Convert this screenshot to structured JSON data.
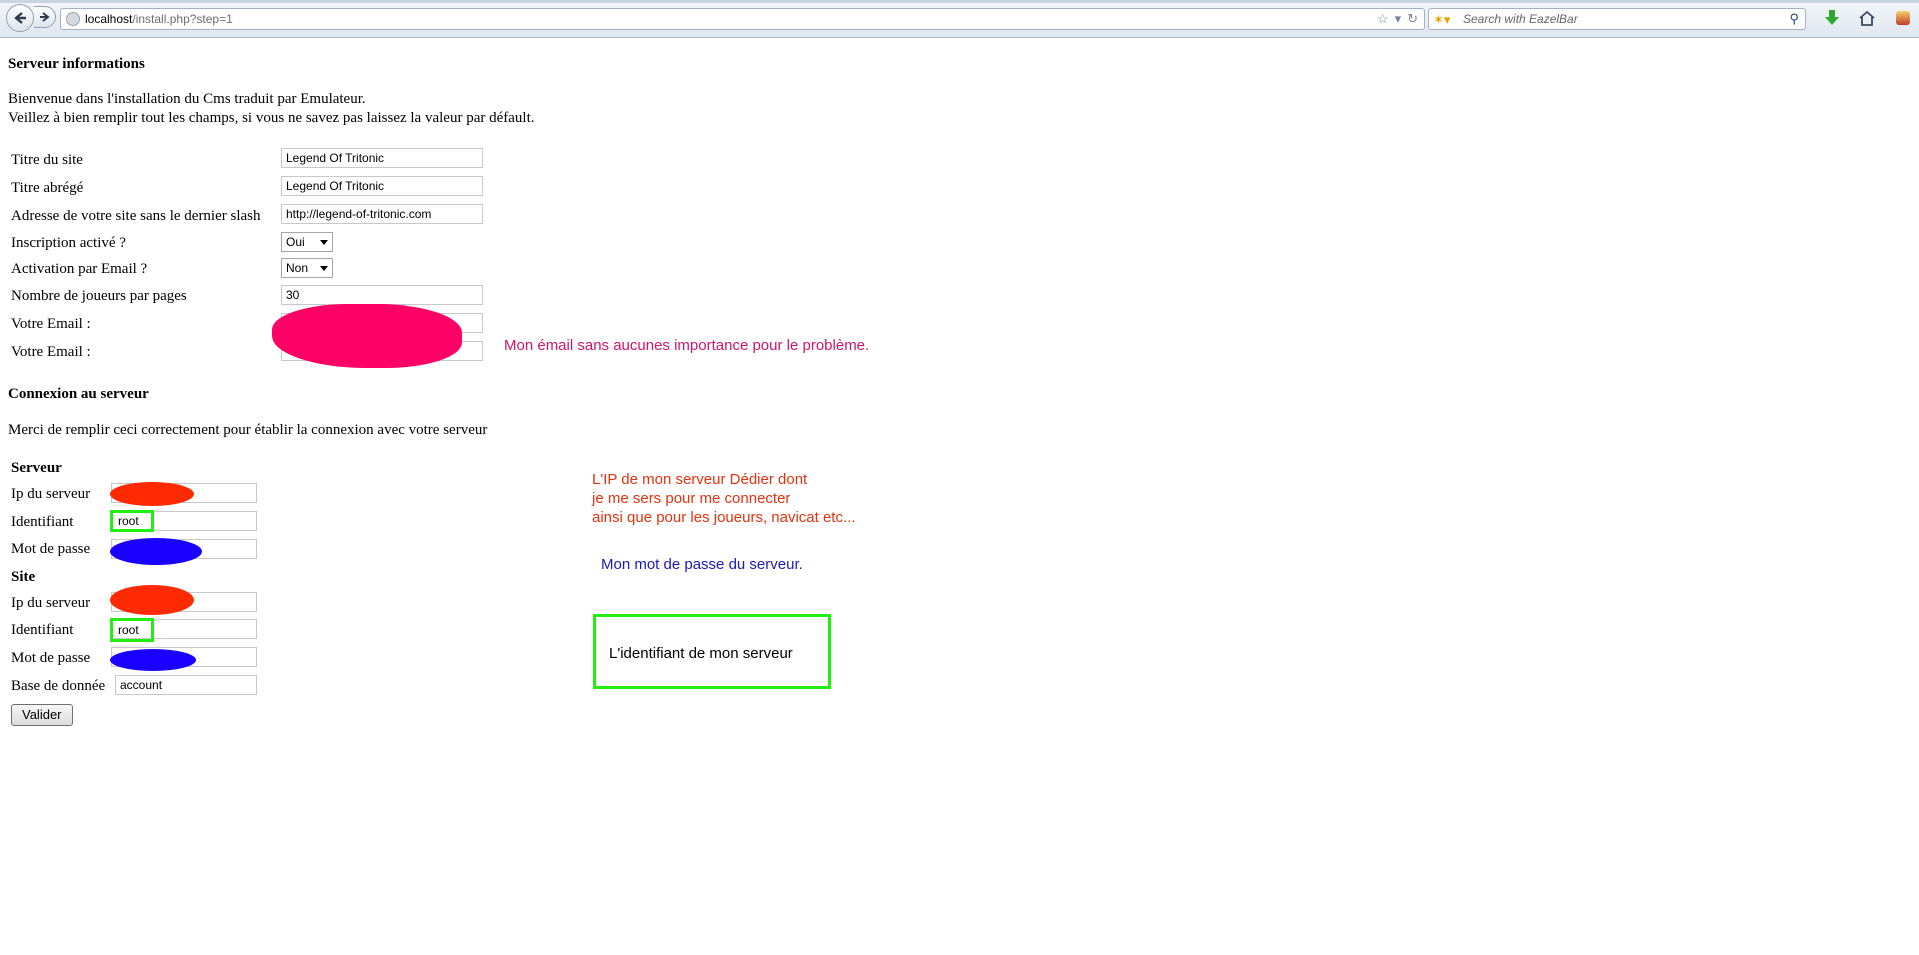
{
  "browser": {
    "url_host": "localhost",
    "url_path": "/install.php?step=1",
    "search_placeholder": "Search with EazelBar"
  },
  "serveur_info": {
    "heading": "Serveur informations",
    "intro_line1": "Bienvenue dans l'installation du Cms traduit par Emulateur.",
    "intro_line2": "Veillez à bien remplir tout les champs, si vous ne savez pas laissez la valeur par défault.",
    "fields": {
      "titre_label": "Titre du site",
      "titre_value": "Legend Of Tritonic",
      "titre_abrege_label": "Titre abrégé",
      "titre_abrege_value": "Legend Of Tritonic",
      "adresse_label": "Adresse de votre site sans le dernier slash",
      "adresse_value": "http://legend-of-tritonic.com",
      "inscription_label": "Inscription activé ?",
      "inscription_value": "Oui",
      "activation_label": "Activation par Email ?",
      "activation_value": "Non",
      "nombre_label": "Nombre de joueurs par pages",
      "nombre_value": "30",
      "email1_label": "Votre Email :",
      "email2_label": "Votre Email :"
    }
  },
  "connexion": {
    "heading": "Connexion au serveur",
    "intro": "Merci de remplir ceci correctement pour établir la connexion avec votre serveur",
    "serveur": {
      "title": "Serveur",
      "ip_label": "Ip du serveur",
      "identifiant_label": "Identifiant",
      "identifiant_value": "root",
      "password_label": "Mot de passe"
    },
    "site": {
      "title": "Site",
      "ip_label": "Ip du serveur",
      "identifiant_label": "Identifiant",
      "identifiant_value": "root",
      "password_label": "Mot de passe",
      "db_label": "Base de donnée",
      "db_value": "account"
    },
    "submit_label": "Valider"
  },
  "annotations": {
    "email_note": "Mon émail sans aucunes importance pour le problème.",
    "ip_note_line1": "L'IP de mon serveur Dédier dont",
    "ip_note_line2": "je me sers pour me connecter",
    "ip_note_line3": "ainsi que pour les joueurs, navicat etc...",
    "password_note": "Mon mot de passe du serveur.",
    "identifiant_note": "L'identifiant de mon serveur"
  },
  "colors": {
    "email_redaction": "#ff0066",
    "ip_redaction": "#ff2a00",
    "password_redaction": "#1a00ff",
    "identifiant_highlight": "#22ee11",
    "email_note": "#d0166b",
    "ip_note": "#e2330f",
    "password_note": "#1a1ab8"
  }
}
